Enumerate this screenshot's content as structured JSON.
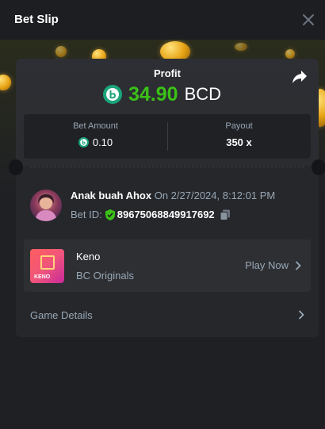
{
  "header": {
    "title": "Bet Slip"
  },
  "profit": {
    "label": "Profit",
    "value": "34.90",
    "currency": "BCD",
    "color": "#3bc117"
  },
  "stats": {
    "bet_amount_label": "Bet Amount",
    "bet_amount_value": "0.10",
    "payout_label": "Payout",
    "payout_value": "350 x"
  },
  "user": {
    "name": "Anak buah Ahox",
    "date": "On 2/27/2024, 8:12:01 PM",
    "bet_id_label": "Bet ID:",
    "bet_id": "89675068849917692"
  },
  "game": {
    "name": "Keno",
    "provider": "BC Originals",
    "thumb_label": "KENO",
    "play_label": "Play Now"
  },
  "details": {
    "label": "Game Details"
  },
  "colors": {
    "background": "#1e2024",
    "card": "#25272b",
    "accent_green": "#3bc117",
    "muted": "#98a7b5"
  },
  "icons": [
    "close-icon",
    "share-icon",
    "bc-coin-icon",
    "verified-shield-icon",
    "copy-icon",
    "chevron-right-icon"
  ]
}
